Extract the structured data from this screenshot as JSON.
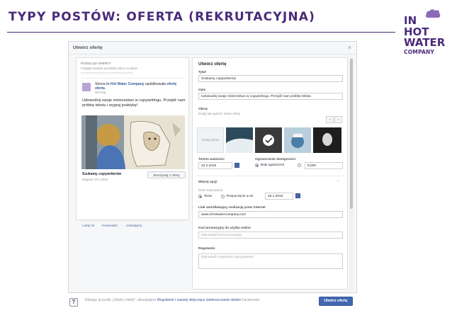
{
  "slide": {
    "title": "TYPY POSTÓW: OFERTA (REKRUTACYJNA)",
    "logo_lines": [
      "IN",
      "HOT",
      "WATER",
      "COMPANY"
    ],
    "accent": "#4b2a7b"
  },
  "dialog": {
    "title": "Utwórz ofertę",
    "close_icon": "×"
  },
  "preview": {
    "label": "PODGLĄD OFERTY",
    "subtitle": "Podgląd podanie przedziela także na adres",
    "url": "inhotwatercompany.com/oferta/kopywriter",
    "page_line_prefix": "Strona",
    "page_name": "In Hot Water Company",
    "page_line_suffix": "opublikowała",
    "page_line2": "ofertę oferta",
    "time": "Wczoraj",
    "post_text": "Udowodnij swoje mistrzostwo w copywritingu. Przejdź nam próbkę tekstu i wygraj praktykę!",
    "job_title": "Szukamy copywriterów",
    "job_date": "Wygasa: 23.2.2016",
    "apply_label": "Skorzystaj z oferty",
    "actions": [
      "Lubię to!",
      "Komentarz",
      "Udostępnij"
    ]
  },
  "form": {
    "title": "Utwórz ofertę",
    "title_label": "Tytuł",
    "title_value": "Szukamy copywriterów",
    "desc_label": "Opis",
    "desc_value": "Udowodnij swoje mistrzostwo w copywritingu. Przejdź nam próbkę tekstu",
    "image_label": "Obraz",
    "image_hint": "Dodaj lub wybierz obraz oferty",
    "upload_label": "Dodaj obraz",
    "nav_prev": "‹",
    "nav_next": "›",
    "expiry_label": "Termin ważności",
    "expiry_value": "23.2.2016",
    "limit_label": "Ograniczenie dostępności",
    "limit_option": "Brak ograniczeń",
    "limit_value": "9,000",
    "more_label": "Więcej opcji",
    "more_chevron": "^",
    "start_label": "Data rozpoczęcia",
    "start_now": "Teraz",
    "start_later": "Rozpoczęcie w dn.",
    "start_date": "25.1.2016",
    "link_label": "Link umożliwiający realizację przez internet",
    "link_value": "www.inhotwatercompany.com",
    "promo_label": "Kod promocyjny do użytku online",
    "promo_placeholder": "Wprowadź kod promocyjny",
    "rules_label": "Regulamin",
    "rules_placeholder": "Wprowadź regulamin (opcjonalnie)"
  },
  "footer": {
    "help_icon": "?",
    "legal_prefix": "Klikając przycisk „Utwórz ofertę\", akceptujesz",
    "legal_link": "Regulamin i zasady dotyczące zamieszczania reklam",
    "legal_suffix": "Facebooka.",
    "create_label": "Utwórz ofertę"
  },
  "colors": {
    "fb_blue": "#4267b2",
    "link_blue": "#365899"
  }
}
